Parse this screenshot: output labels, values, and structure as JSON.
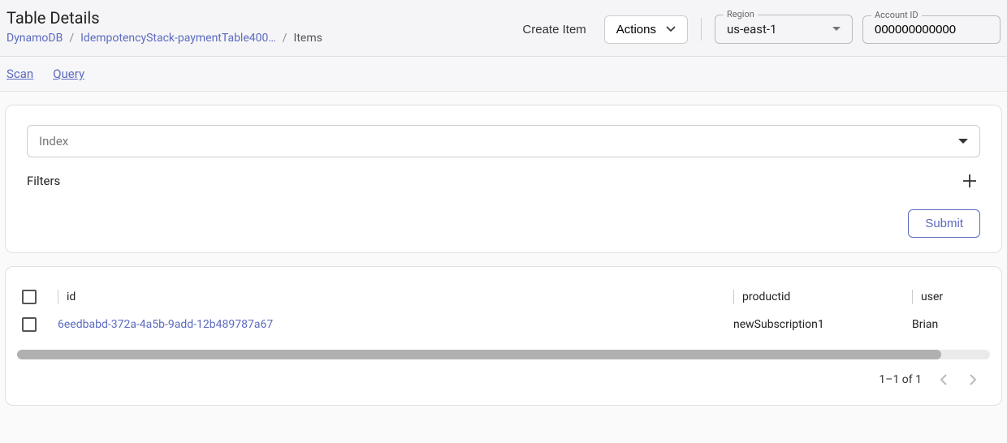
{
  "header": {
    "title": "Table Details",
    "breadcrumb": {
      "root": "DynamoDB",
      "table": "IdempotencyStack-paymentTable400…",
      "current": "Items"
    },
    "createItem": "Create Item",
    "actions": "Actions",
    "region": {
      "label": "Region",
      "value": "us-east-1"
    },
    "account": {
      "label": "Account ID",
      "value": "000000000000"
    }
  },
  "tabs": {
    "scan": "Scan",
    "query": "Query"
  },
  "scanPanel": {
    "indexPlaceholder": "Index",
    "filtersLabel": "Filters",
    "submit": "Submit"
  },
  "table": {
    "columns": {
      "id": "id",
      "productid": "productid",
      "user": "user"
    },
    "rows": [
      {
        "id": "6eedbabd-372a-4a5b-9add-12b489787a67",
        "productid": "newSubscription1",
        "user": "Brian"
      }
    ]
  },
  "pager": {
    "range": "1–1 of 1"
  }
}
